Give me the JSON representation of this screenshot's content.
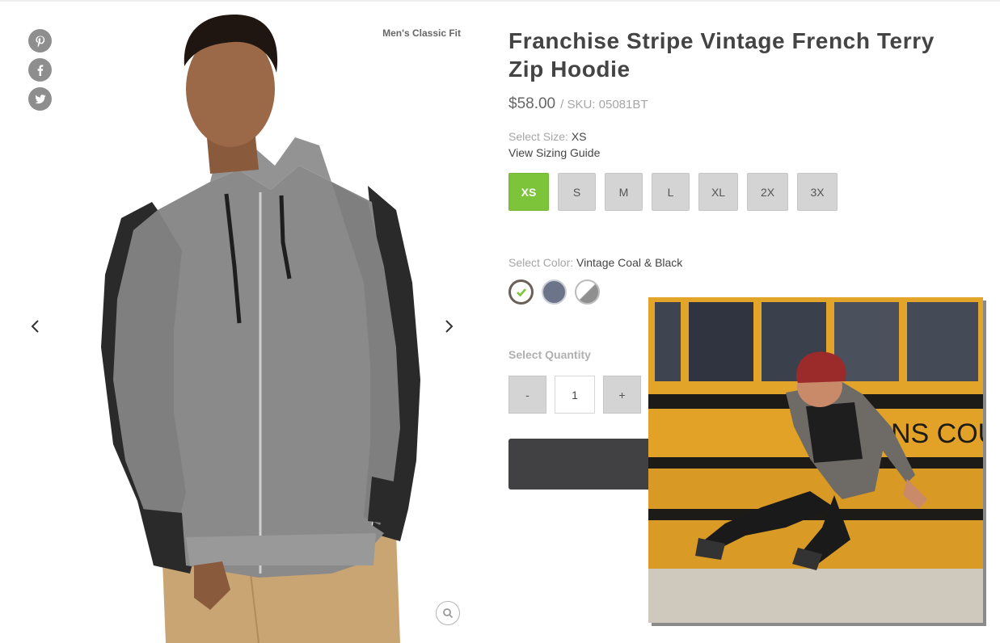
{
  "social": {
    "icons": [
      "pinterest-icon",
      "facebook-icon",
      "twitter-icon"
    ]
  },
  "gallery": {
    "fit_label": "Men's Classic Fit",
    "prev_icon": "chevron-left-icon",
    "next_icon": "chevron-right-icon",
    "zoom_icon": "magnifier-icon"
  },
  "product": {
    "title": "Franchise Stripe Vintage French Terry Zip Hoodie",
    "price": "$58.00",
    "sku": "/ SKU: 05081BT",
    "size_label": "Select Size:",
    "size_value": "XS",
    "sizing_guide": "View Sizing Guide",
    "sizes": [
      "XS",
      "S",
      "M",
      "L",
      "XL",
      "2X",
      "3X"
    ],
    "selected_size": "XS",
    "color_label": "Select Color:",
    "color_value": "Vintage Coal & Black",
    "quantity_label": "Select Quantity",
    "qty_minus": "-",
    "qty_value": "1",
    "qty_plus": "+"
  },
  "colors": {
    "accent_green": "#7dc43a",
    "button_dark": "#414042",
    "size_grey": "#d4d4d4"
  }
}
